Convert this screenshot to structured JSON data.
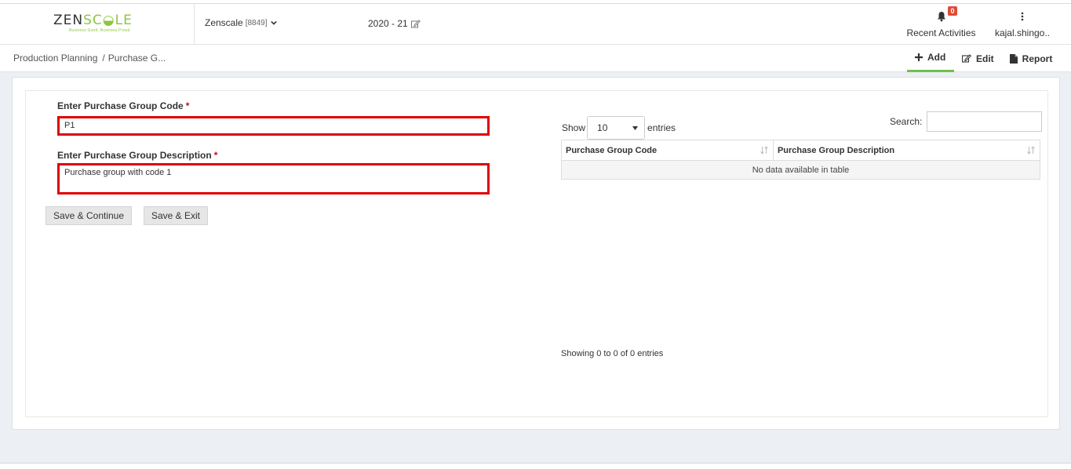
{
  "header": {
    "logo_text_a": "ZEN",
    "logo_text_b": "SC",
    "logo_text_c": "LE",
    "logo_tagline": "Business Good. Business Proud.",
    "company_name": "Zenscale",
    "company_code": "[8849]",
    "fiscal_year": "2020 - 21",
    "notifications_count": "0",
    "recent_activities_label": "Recent Activities",
    "user_name": "kajal.shingo.."
  },
  "breadcrumb": {
    "module": "Production Planning",
    "separator": "/",
    "page": "Purchase G..."
  },
  "actions": {
    "add": "Add",
    "edit": "Edit",
    "report": "Report"
  },
  "form": {
    "code_label": "Enter Purchase Group Code",
    "code_value": "P1",
    "description_label": "Enter Purchase Group Description",
    "description_value": "Purchase group with code 1",
    "required_mark": "*",
    "save_continue": "Save & Continue",
    "save_exit": "Save & Exit"
  },
  "table": {
    "show_label": "Show",
    "page_size": "10",
    "entries_label": "entries",
    "search_label": "Search:",
    "columns": [
      "Purchase Group Code",
      "Purchase Group Description"
    ],
    "empty_message": "No data available in table",
    "info": "Showing 0 to 0 of 0 entries"
  },
  "colors": {
    "brand_green": "#8cc63f",
    "active_tab": "#6fbf4a",
    "badge": "#e04b36",
    "highlight_border": "#e00000"
  }
}
